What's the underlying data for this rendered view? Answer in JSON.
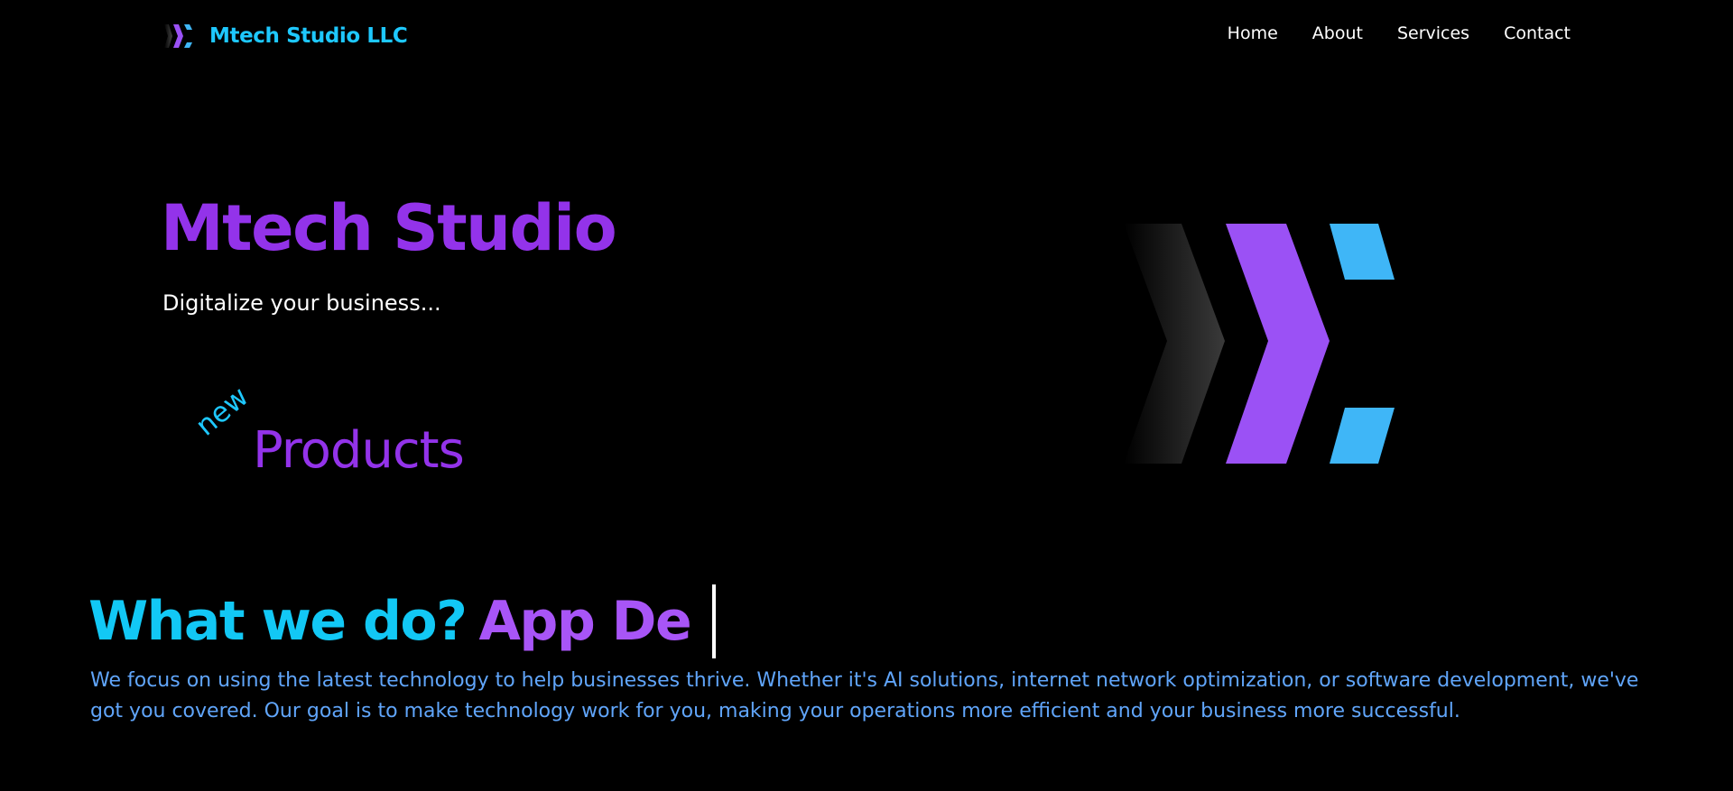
{
  "header": {
    "brand_name": "Mtech Studio LLC",
    "nav": [
      {
        "label": "Home"
      },
      {
        "label": "About"
      },
      {
        "label": "Services"
      },
      {
        "label": "Contact"
      }
    ]
  },
  "hero": {
    "title": "Mtech Studio",
    "subtitle": "Digitalize your business...",
    "new_label": "new",
    "products_label": "Products",
    "logo_icon": "mtech-chevron-logo"
  },
  "what_we_do": {
    "heading": "What we do?",
    "typed_text": "App De",
    "description": "We focus on using the latest technology to help businesses thrive. Whether it's AI solutions, internet network optimization, or software development, we've got you covered. Our goal is to make technology work for you, making your operations more efficient and your business more successful."
  },
  "colors": {
    "background": "#000000",
    "purple": "#9333ea",
    "logo_purple": "#9b51f5",
    "cyan": "#1ec8ff",
    "logo_blue": "#3fb6f7",
    "description_blue": "#60a5fa"
  }
}
